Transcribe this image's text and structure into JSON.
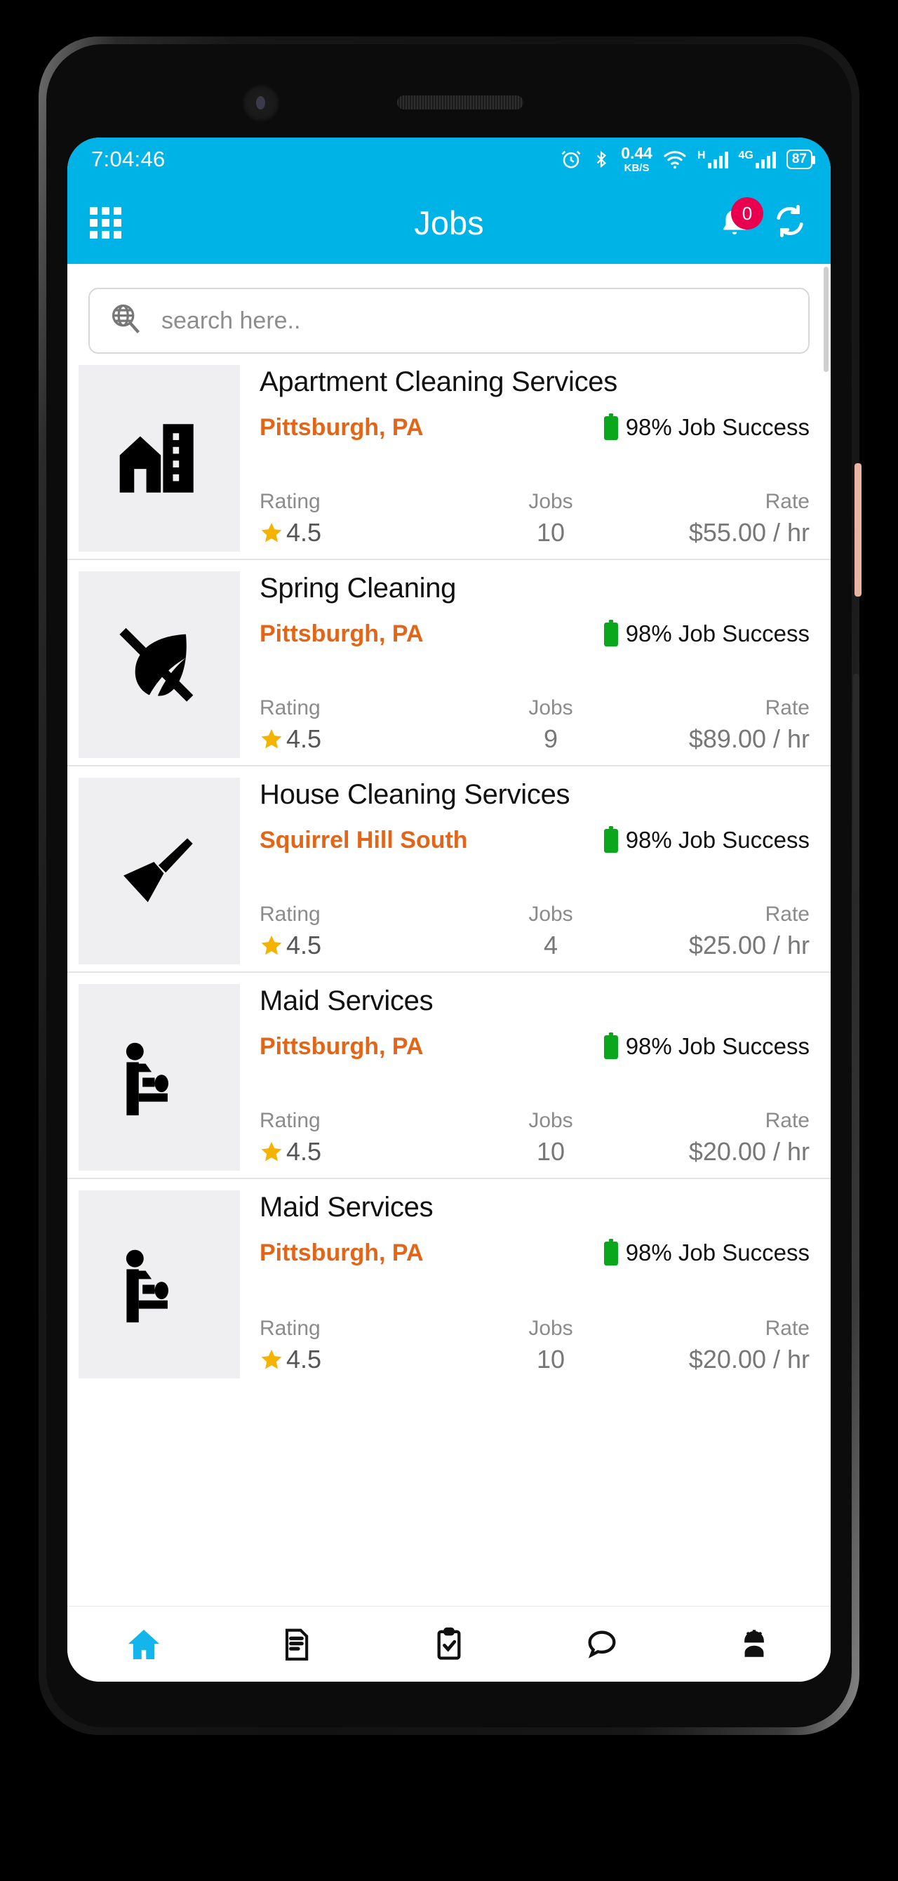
{
  "status_bar": {
    "time": "7:04:46",
    "net_speed_value": "0.44",
    "net_speed_unit": "KB/S",
    "network_h": "H",
    "network_4g": "4G",
    "battery": "87",
    "icons": [
      "alarm-icon",
      "bluetooth-icon",
      "wifi-icon",
      "signal-h-icon",
      "signal-4g-icon",
      "battery-icon"
    ]
  },
  "app_bar": {
    "title": "Jobs",
    "menu_icon": "grid-menu-icon",
    "notification_icon": "bell-icon",
    "notification_count": "0",
    "refresh_icon": "refresh-icon"
  },
  "search": {
    "placeholder": "search here..",
    "value": "",
    "icon": "globe-search-icon"
  },
  "colors": {
    "accent_blue": "#00b3e6",
    "location_orange": "#e2661a",
    "badge_red": "#e8004f",
    "success_green": "#0aa61b",
    "star_yellow": "#f5b301"
  },
  "labels": {
    "rating": "Rating",
    "jobs": "Jobs",
    "rate": "Rate"
  },
  "jobs": [
    {
      "title": "Apartment Cleaning Services",
      "location": "Pittsburgh, PA",
      "success": "98% Job Success",
      "rating": "4.5",
      "jobs_count": "10",
      "rate": "$55.00 / hr",
      "icon": "apartment-building-icon"
    },
    {
      "title": "Spring Cleaning",
      "location": "Pittsburgh, PA",
      "success": "98% Job Success",
      "rating": "4.5",
      "jobs_count": "9",
      "rate": "$89.00 / hr",
      "icon": "leaf-slash-icon"
    },
    {
      "title": "House Cleaning Services",
      "location": "Squirrel Hill South",
      "success": "98% Job Success",
      "rating": "4.5",
      "jobs_count": "4",
      "rate": "$25.00 / hr",
      "icon": "broom-icon"
    },
    {
      "title": "Maid Services",
      "location": "Pittsburgh, PA",
      "success": "98% Job Success",
      "rating": "4.5",
      "jobs_count": "10",
      "rate": "$20.00 / hr",
      "icon": "maid-cleaning-icon"
    },
    {
      "title": "Maid Services",
      "location": "Pittsburgh, PA",
      "success": "98% Job Success",
      "rating": "4.5",
      "jobs_count": "10",
      "rate": "$20.00 / hr",
      "icon": "maid-cleaning-icon"
    }
  ],
  "bottom_nav": [
    {
      "icon": "home-icon",
      "active": true
    },
    {
      "icon": "document-icon",
      "active": false
    },
    {
      "icon": "clipboard-check-icon",
      "active": false
    },
    {
      "icon": "chat-bubble-icon",
      "active": false
    },
    {
      "icon": "worker-icon",
      "active": false
    }
  ]
}
